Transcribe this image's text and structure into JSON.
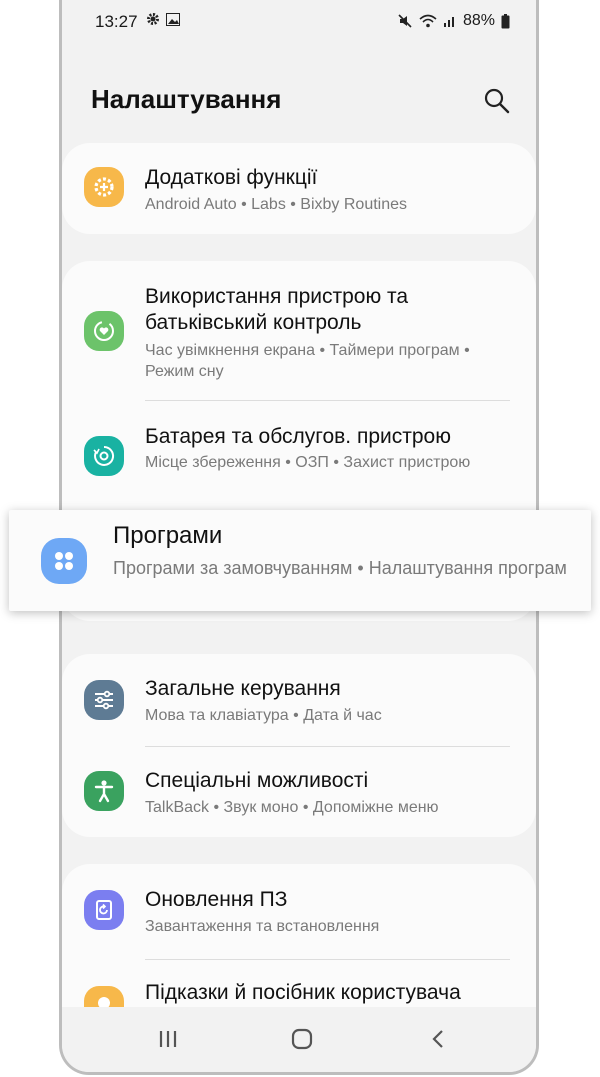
{
  "status_bar": {
    "time": "13:27",
    "battery": "88%"
  },
  "header": {
    "title": "Налаштування"
  },
  "items": [
    {
      "title": "Додаткові функції",
      "subtitle": "Android Auto  •  Labs  •  Bixby Routines",
      "color": "#f7b84a"
    },
    {
      "title": "Використання пристрою та батьківський контроль",
      "subtitle": "Час увімкнення екрана  •  Таймери програм  •  Режим сну",
      "color": "#6cc36a"
    },
    {
      "title": "Батарея та обслугов. пристрою",
      "subtitle": "Місце збереження  •  ОЗП  •  Захист пристрою",
      "color": "#19b2a2"
    },
    {
      "title": "Програми",
      "subtitle": "Програми за замовчуванням  •  Налаштування програм",
      "color": "#6ea8f5"
    },
    {
      "title": "Загальне керування",
      "subtitle": "Мова та клавіатура  •  Дата й час",
      "color": "#5e7b94"
    },
    {
      "title": "Спеціальні можливості",
      "subtitle": "TalkBack  •  Звук моно  •  Допоміжне меню",
      "color": "#3aa25f"
    },
    {
      "title": "Оновлення ПЗ",
      "subtitle": "Завантаження та встановлення",
      "color": "#7b7ef0"
    },
    {
      "title": "Підказки й посібник користувача",
      "subtitle": "",
      "color": "#f7b84a"
    }
  ]
}
